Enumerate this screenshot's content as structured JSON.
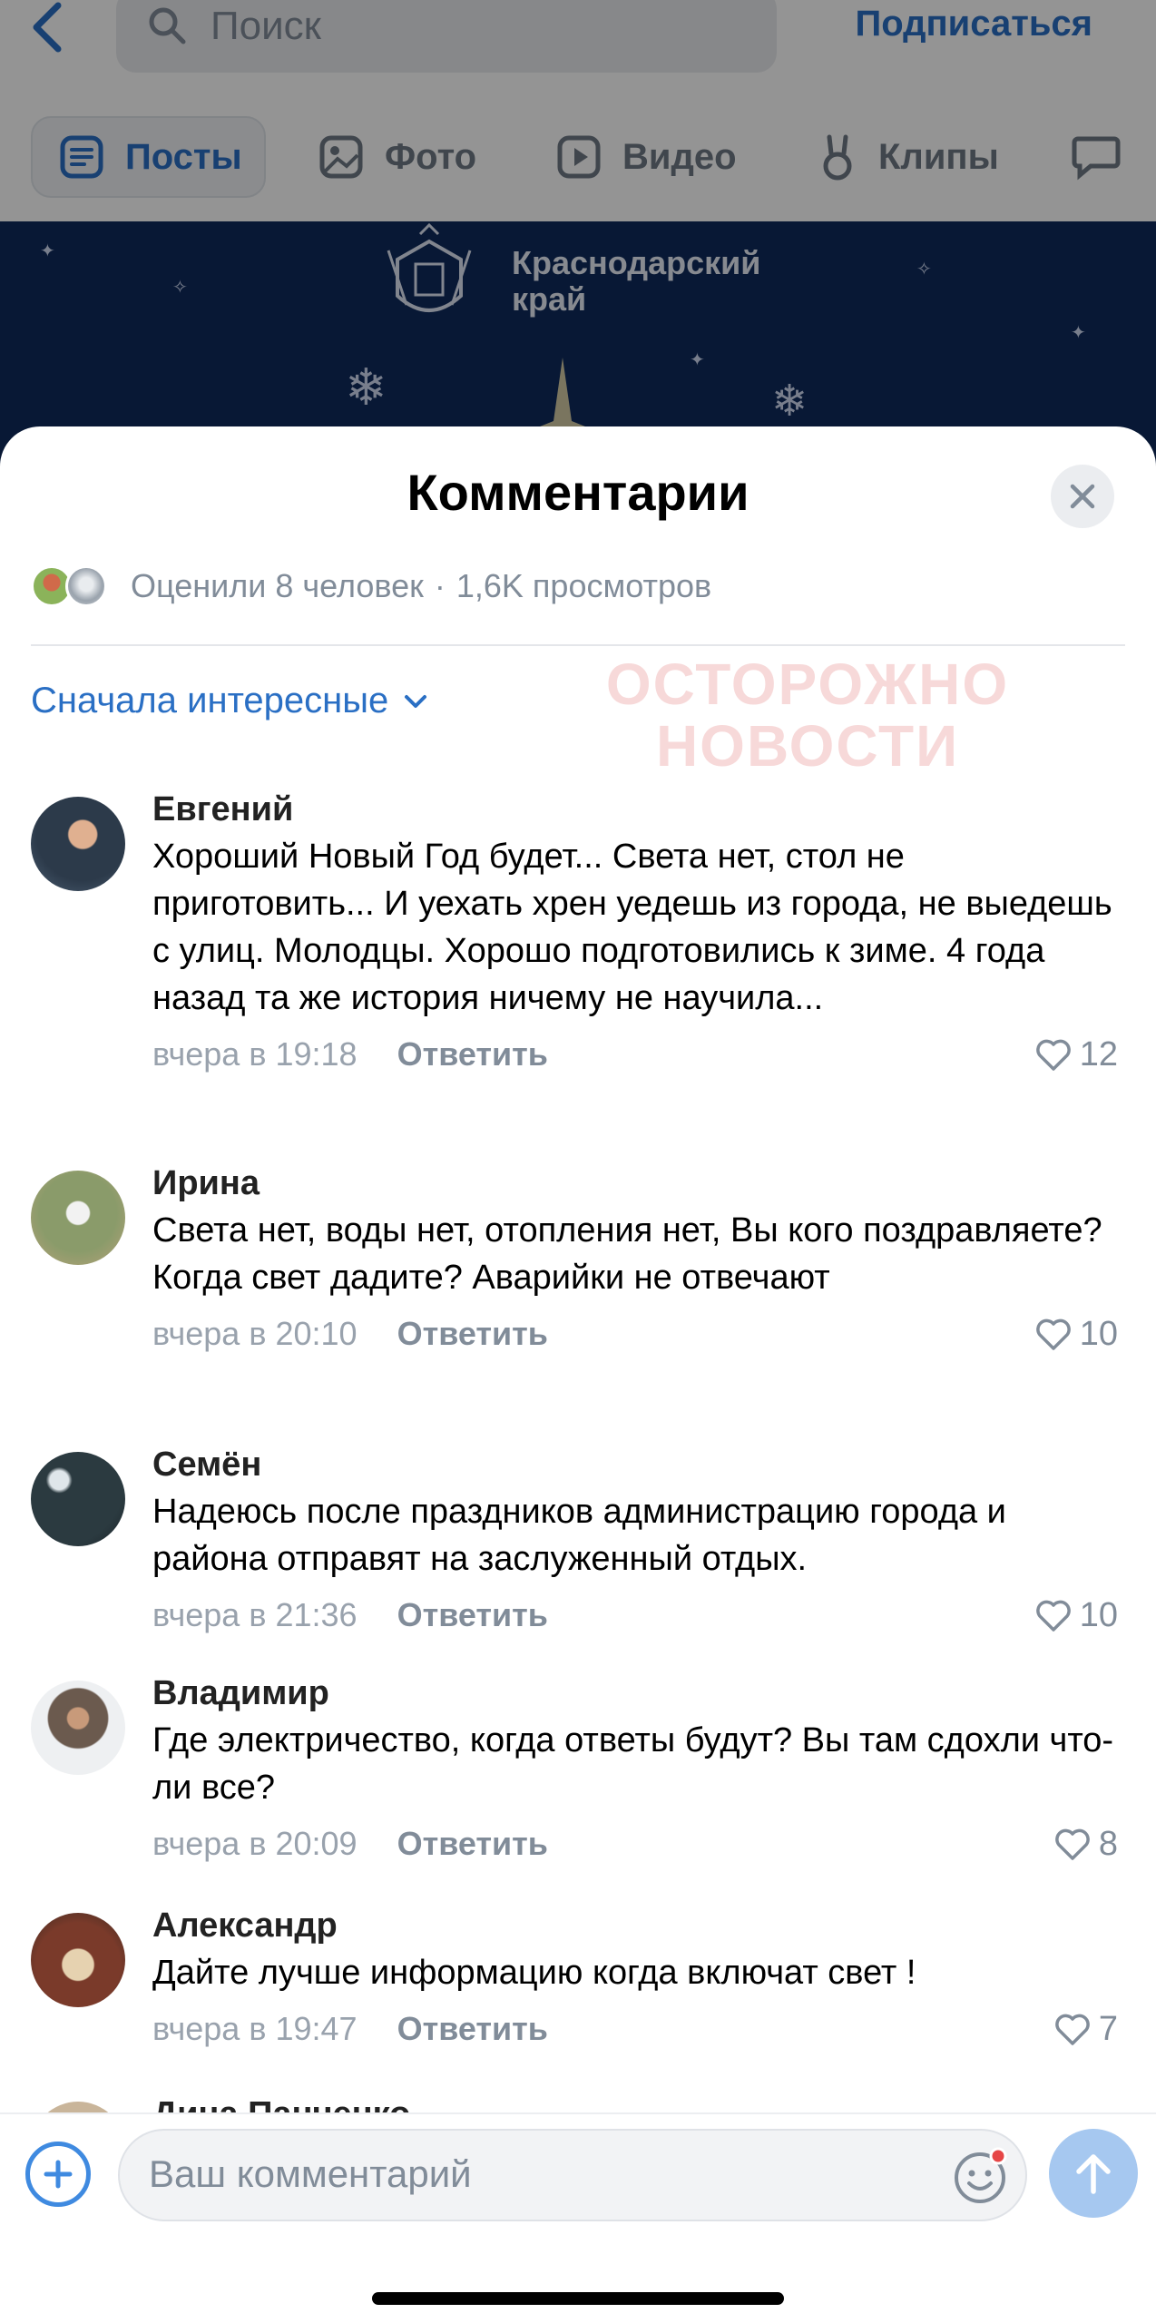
{
  "header": {
    "search_placeholder": "Поиск",
    "subscribe_label": "Подписаться"
  },
  "tabs": [
    {
      "label": "Посты",
      "icon": "posts-icon",
      "active": true
    },
    {
      "label": "Фото",
      "icon": "photo-icon"
    },
    {
      "label": "Видео",
      "icon": "video-icon"
    },
    {
      "label": "Клипы",
      "icon": "clips-icon"
    }
  ],
  "banner": {
    "title_line1": "Краснодарский",
    "title_line2": "край"
  },
  "sheet": {
    "title": "Комментарии",
    "likes_text": "Оценили 8 человек",
    "views_text": "1,6K просмотров",
    "separator": "·",
    "sort_label": "Сначала интересные",
    "watermark_line1": "ОСТОРОЖНО",
    "watermark_line2": "НОВОСТИ"
  },
  "comments": [
    {
      "name": "Евгений",
      "text": "Хороший Новый Год будет... Света нет, стол не приготовить... И уехать хрен уедешь из города, не выедешь с улиц. Молодцы. Хорошо подготовились к зиме. 4 года назад та же история ничему не научила...",
      "time": "вчера в 19:18",
      "reply": "Ответить",
      "likes": "12"
    },
    {
      "name": "Ирина",
      "text": "Света нет, воды нет, отопления нет, Вы кого поздравляете? Когда свет дадите? Аварийки не отвечают",
      "time": "вчера в 20:10",
      "reply": "Ответить",
      "likes": "10"
    },
    {
      "name": "Семён",
      "text": "Надеюсь после праздников администрацию города и района отправят на заслуженный отдых.",
      "time": "вчера в 21:36",
      "reply": "Ответить",
      "likes": "10"
    },
    {
      "name": "Владимир",
      "text": "Где электричество, когда ответы будут? Вы там сдохли что-ли все?",
      "time": "вчера в 20:09",
      "reply": "Ответить",
      "likes": "8"
    },
    {
      "name": "Александр",
      "text": "Дайте лучше информацию когда включат свет !",
      "time": "вчера в 19:47",
      "reply": "Ответить",
      "likes": "7"
    }
  ],
  "partial_comment_name": "Дина Панченко",
  "composer": {
    "placeholder": "Ваш комментарий"
  },
  "colors": {
    "accent": "#2a6fc4",
    "secondary_text": "#818c99",
    "banner_bg": "#0e2a5c"
  }
}
